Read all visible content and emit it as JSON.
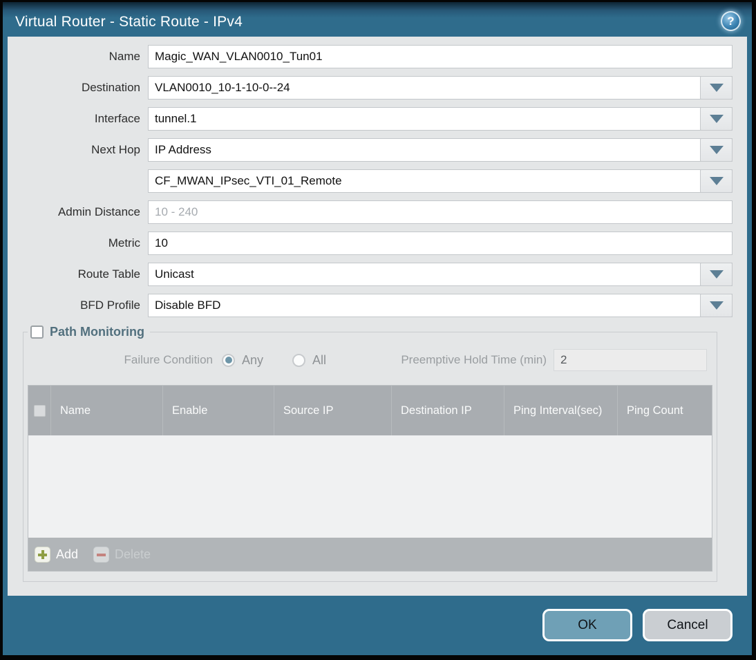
{
  "window": {
    "title": "Virtual Router - Static Route - IPv4",
    "help_glyph": "?"
  },
  "form": {
    "rows": [
      {
        "label": "Name",
        "value": "Magic_WAN_VLAN0010_Tun01",
        "type": "text"
      },
      {
        "label": "Destination",
        "value": "VLAN0010_10-1-10-0--24",
        "type": "combo"
      },
      {
        "label": "Interface",
        "value": "tunnel.1",
        "type": "combo"
      },
      {
        "label": "Next Hop",
        "value": "IP Address",
        "type": "combo"
      },
      {
        "label": "",
        "value": "CF_MWAN_IPsec_VTI_01_Remote",
        "type": "combo"
      },
      {
        "label": "Admin Distance",
        "value": "",
        "placeholder": "10 - 240",
        "type": "text"
      },
      {
        "label": "Metric",
        "value": "10",
        "type": "text"
      },
      {
        "label": "Route Table",
        "value": "Unicast",
        "type": "combo"
      },
      {
        "label": "BFD Profile",
        "value": "Disable BFD",
        "type": "combo"
      }
    ]
  },
  "path_monitoring": {
    "legend": "Path Monitoring",
    "checkbox_checked": false,
    "failure_condition_label": "Failure Condition",
    "failure_options": {
      "any": "Any",
      "all": "All",
      "selected": "Any"
    },
    "preemptive_label": "Preemptive Hold Time (min)",
    "preemptive_value": "2",
    "table": {
      "columns": [
        "Name",
        "Enable",
        "Source IP",
        "Destination IP",
        "Ping Interval(sec)",
        "Ping Count"
      ],
      "rows": []
    },
    "toolbar": {
      "add_label": "Add",
      "delete_label": "Delete"
    }
  },
  "dialog_buttons": {
    "ok_label": "OK",
    "cancel_label": "Cancel"
  },
  "colors": {
    "titlebar": "#2f6c8c",
    "content_bg": "#e4e6e7",
    "table_header_bg": "#a9adb1",
    "ok_button": "#6fa0b6",
    "cancel_button": "#caced2",
    "add_plus": "#8f9e44",
    "delete_minus": "#c4837f",
    "legend_text": "#52707e",
    "radio_dot": "#6e96a9"
  }
}
